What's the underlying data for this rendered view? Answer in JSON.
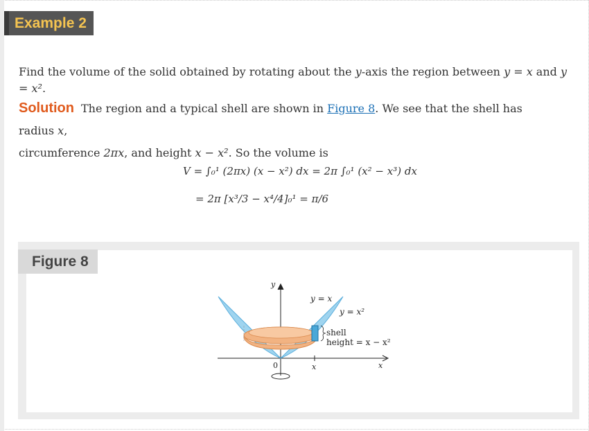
{
  "example_label": "Example 2",
  "problem": {
    "text_1": "Find the volume of the solid obtained by rotating about the ",
    "var_y": "y",
    "text_2": "-axis the region between ",
    "eq_a": "y = x",
    "text_3": " and ",
    "eq_b": "y = x²",
    "text_4": "."
  },
  "solution": {
    "label": "Solution",
    "text_1": "The region and a typical shell are shown in ",
    "link": "Figure 8",
    "text_2": ". We see that the shell has radius ",
    "radius": "x",
    "text_3": ",",
    "text_4": "circumference ",
    "circumference": "2πx",
    "text_5": ", and height ",
    "height": "x − x²",
    "text_6": ". So the volume is"
  },
  "equations": {
    "line_1": "V = ∫₀¹ (2πx) (x − x²) dx = 2π ∫₀¹ (x² − x³) dx",
    "line_2": "= 2π [x³/3 − x⁴/4]₀¹ = π/6"
  },
  "figure": {
    "label": "Figure 8",
    "y_axis": "y",
    "x_axis": "x",
    "origin": "0",
    "x_tick": "x",
    "curve_line": "y = x",
    "curve_parabola": "y = x²",
    "shell_label": "shell",
    "height_label": "height = x − x²",
    "colors": {
      "bowl": "#f2b382",
      "bowl_dark": "#d9894d",
      "region": "#9fd4ef",
      "region_edge": "#5aaedc",
      "shell": "#4aa8d8"
    }
  }
}
